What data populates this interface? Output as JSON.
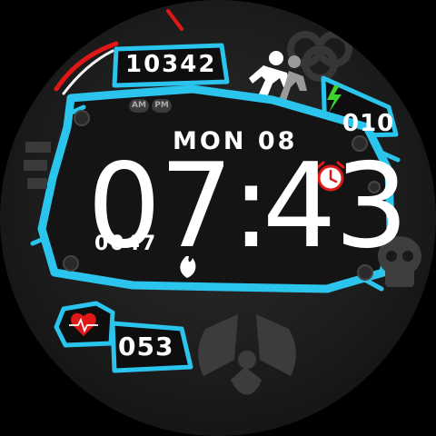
{
  "watchface": {
    "steps": "10342",
    "battery": "010",
    "date": "MON 08",
    "time": {
      "hour": "07",
      "separator": ":",
      "minute": "43"
    },
    "calories": "0047",
    "heart_rate": "053",
    "ampm": {
      "am": "AM",
      "pm": "PM"
    }
  },
  "colors": {
    "accent": "#2bc4ec",
    "alert": "#e01717",
    "battery": "#3bd12e",
    "text": "#ffffff"
  },
  "icons": [
    "runner-icon",
    "battery-bolt-icon",
    "alarm-clock-icon",
    "flame-icon",
    "heart-icon",
    "radiation-icon",
    "skull-icon",
    "biohazard-icon"
  ]
}
